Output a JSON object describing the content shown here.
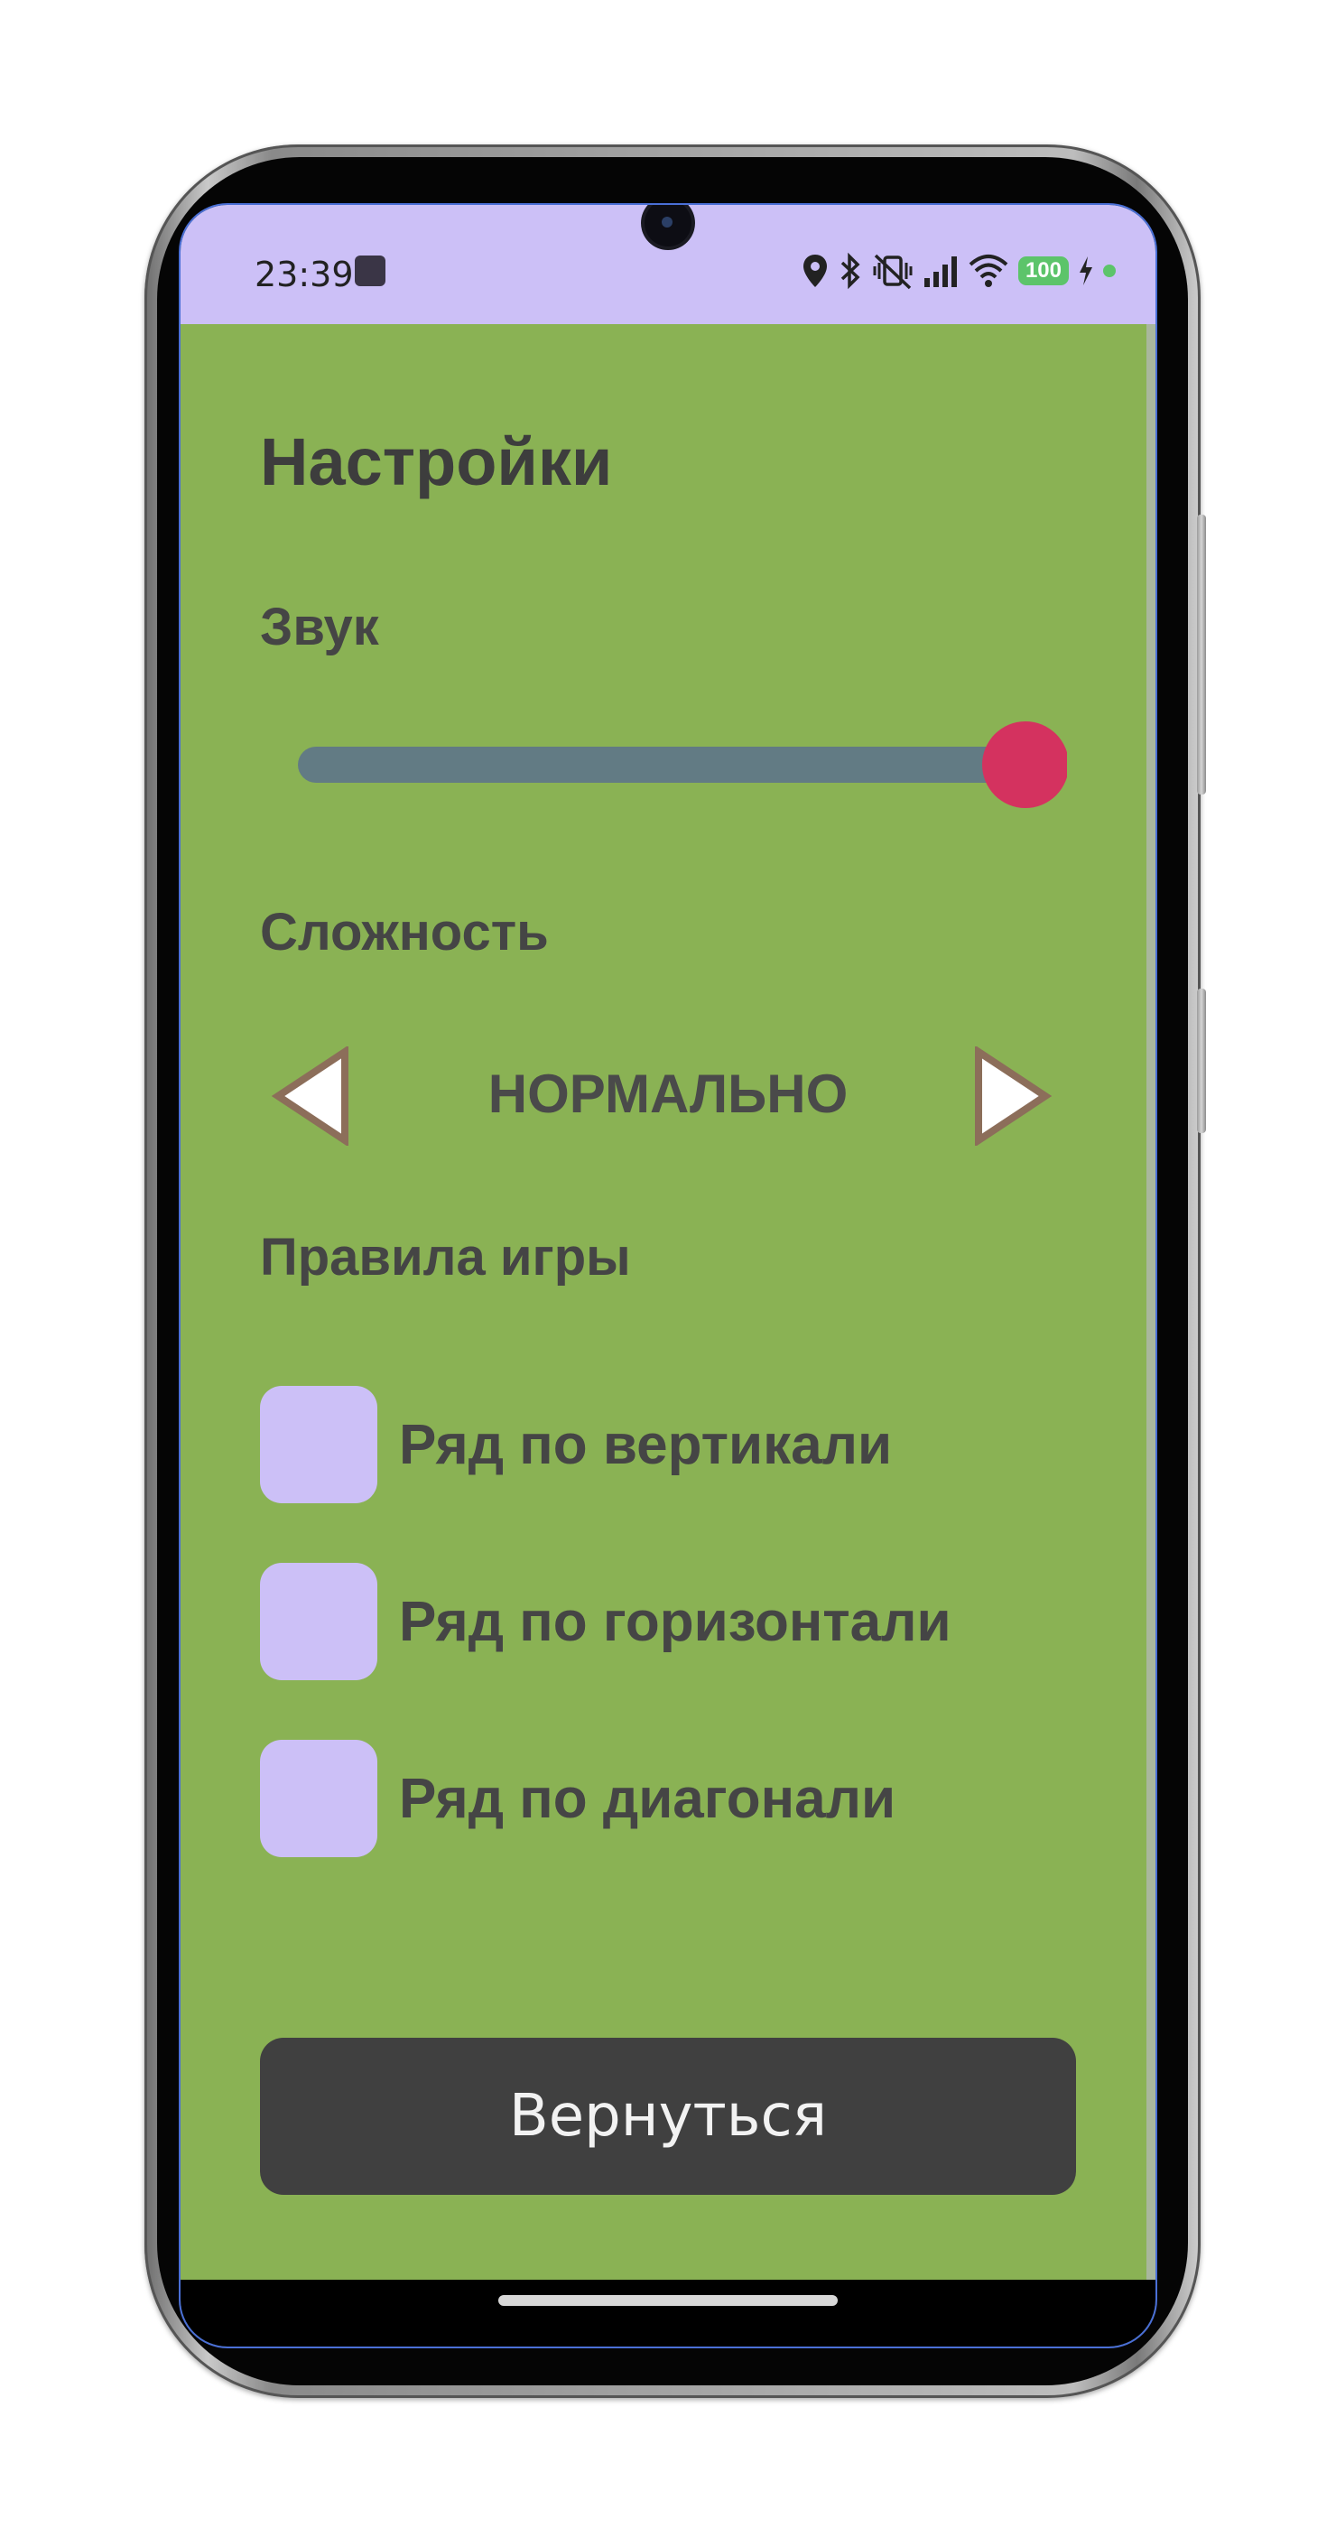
{
  "colors": {
    "screen_background": "#8ab254",
    "status_bar": "#ccc0f7",
    "slider_track": "#627b84",
    "slider_thumb": "#d4325f",
    "checkbox": "#ccc0f7",
    "button_background": "#404040",
    "arrow_outline": "#8c6e5a"
  },
  "status_bar": {
    "time": "23:39",
    "battery": "100",
    "icons": [
      "location-icon",
      "bluetooth-icon",
      "vibrate-off-icon",
      "signal-icon",
      "wifi-icon",
      "battery-icon",
      "charging-icon"
    ]
  },
  "settings": {
    "title": "Настройки",
    "sound": {
      "label": "Звук",
      "volume_fraction": 1.0
    },
    "difficulty": {
      "label": "Сложность",
      "value": "НОРМАЛЬНО",
      "prev_icon": "triangle-left-icon",
      "next_icon": "triangle-right-icon"
    },
    "rules": {
      "label": "Правила игры",
      "items": [
        {
          "label": "Ряд по вертикали",
          "checked": false
        },
        {
          "label": "Ряд по горизонтали",
          "checked": false
        },
        {
          "label": "Ряд по диагонали",
          "checked": false
        }
      ]
    },
    "back_button": "Вернуться"
  }
}
